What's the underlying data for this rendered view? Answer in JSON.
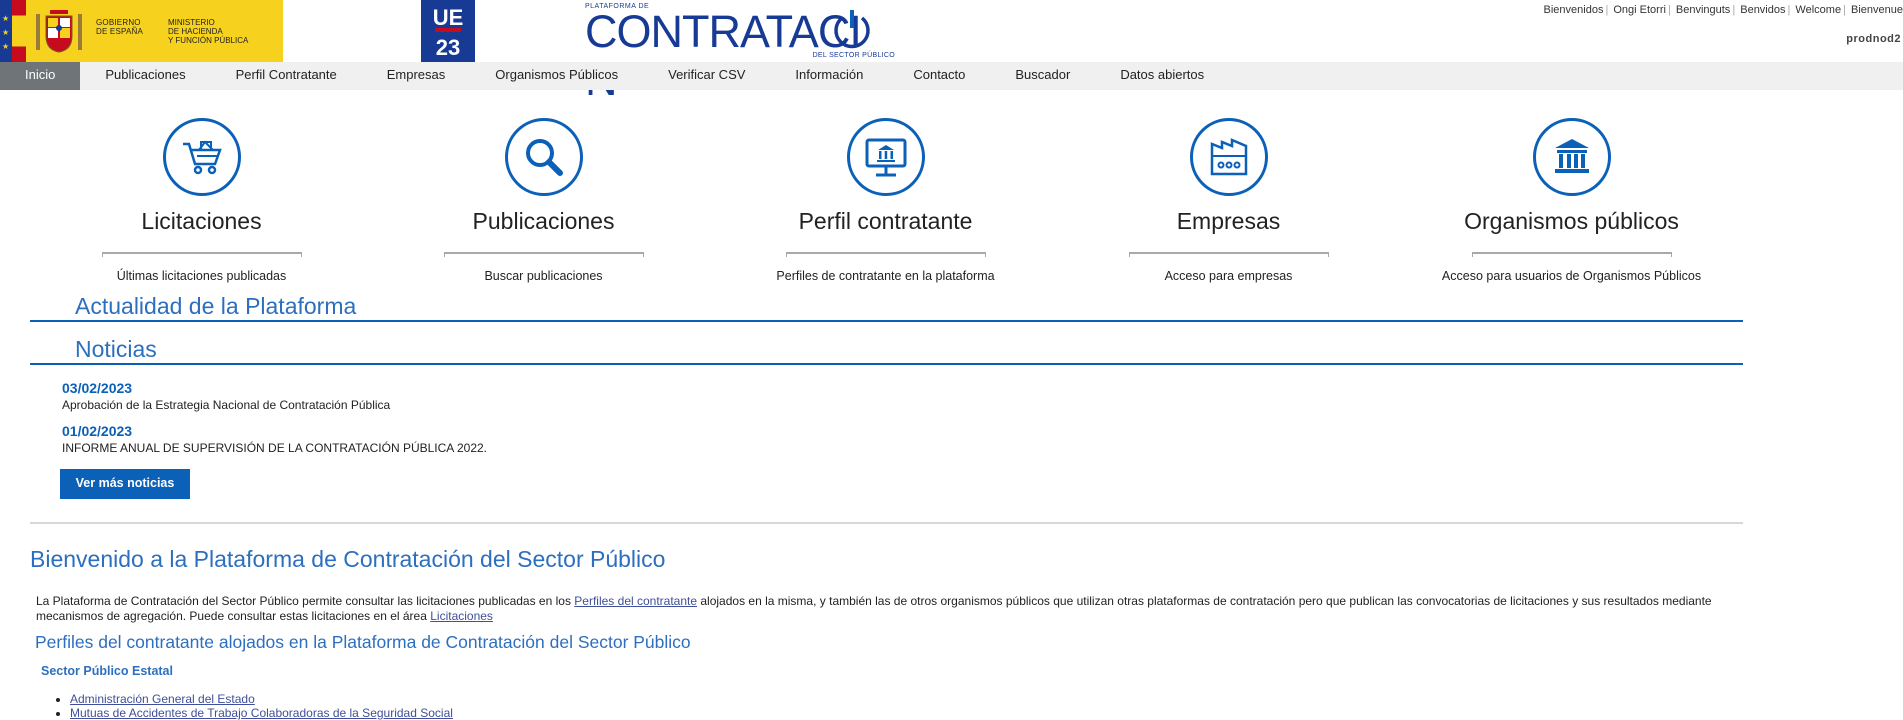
{
  "header": {
    "gov_text": "GOBIERNO\nDE ESPAÑA",
    "ministry_text": "MINISTERIO\nDE HACIENDA\nY FUNCIÓN PÚBLICA",
    "ue_line1": "UE",
    "ue_line2": "23",
    "brand_top": "PLATAFORMA DE",
    "brand_main": "CONTRATACI",
    "brand_main_end": "N",
    "brand_bottom": "DEL SECTOR PÚBLICO",
    "lang_links": [
      "Bienvenidos",
      "Ongi Etorri",
      "Benvinguts",
      "Benvidos",
      "Welcome",
      "Bienvenue"
    ],
    "user": "prodnod2"
  },
  "nav": {
    "items": [
      "Inicio",
      "Publicaciones",
      "Perfil Contratante",
      "Empresas",
      "Organismos Públicos",
      "Verificar CSV",
      "Información",
      "Contacto",
      "Buscador",
      "Datos abiertos"
    ],
    "active_index": 0
  },
  "tiles": [
    {
      "title": "Licitaciones",
      "subtitle": "Últimas licitaciones publicadas",
      "icon": "shopping-cart-icon"
    },
    {
      "title": "Publicaciones",
      "subtitle": "Buscar publicaciones",
      "icon": "search-icon"
    },
    {
      "title": "Perfil contratante",
      "subtitle": "Perfiles de contratante en la plataforma",
      "icon": "monitor-building-icon"
    },
    {
      "title": "Empresas",
      "subtitle": "Acceso para empresas",
      "icon": "factory-icon"
    },
    {
      "title": "Organismos públicos",
      "subtitle": "Acceso para usuarios de Organismos Públicos",
      "icon": "institution-icon"
    }
  ],
  "news": {
    "section_title": "Actualidad de la Plataforma",
    "news_title": "Noticias",
    "items": [
      {
        "date": "03/02/2023",
        "text": "Aprobación de la Estrategia Nacional de Contratación Pública"
      },
      {
        "date": "01/02/2023",
        "text": "INFORME ANUAL DE SUPERVISIÓN DE LA CONTRATACIÓN PÚBLICA 2022."
      }
    ],
    "more_button": "Ver más noticias"
  },
  "welcome": {
    "title": "Bienvenido a la Plataforma de Contratación del Sector Público",
    "intro_part1": "La Plataforma de Contratación del Sector Público permite consultar las licitaciones publicadas en los ",
    "intro_link1": "Perfiles del contratante",
    "intro_part2": " alojados en la misma, y también las de otros organismos públicos que utilizan otras plataformas de contratación pero que publican las convocatorias de licitaciones y sus resultados mediante mecanismos de agregación. Puede consultar estas licitaciones en el área ",
    "intro_link2": "Licitaciones",
    "profiles_title": "Perfiles del contratante alojados en la Plataforma de Contratación del Sector Público",
    "sector_label": "Sector Público Estatal",
    "sector_items": [
      "Administración General del Estado",
      "Mutuas de Accidentes de Trabajo Colaboradoras de la Seguridad Social"
    ]
  },
  "colors": {
    "accent": "#0b60b8",
    "heading": "#2d6fbf",
    "nav_active": "#6e7478",
    "gov_yellow": "#f6d21f",
    "eu_blue": "#173b95"
  }
}
